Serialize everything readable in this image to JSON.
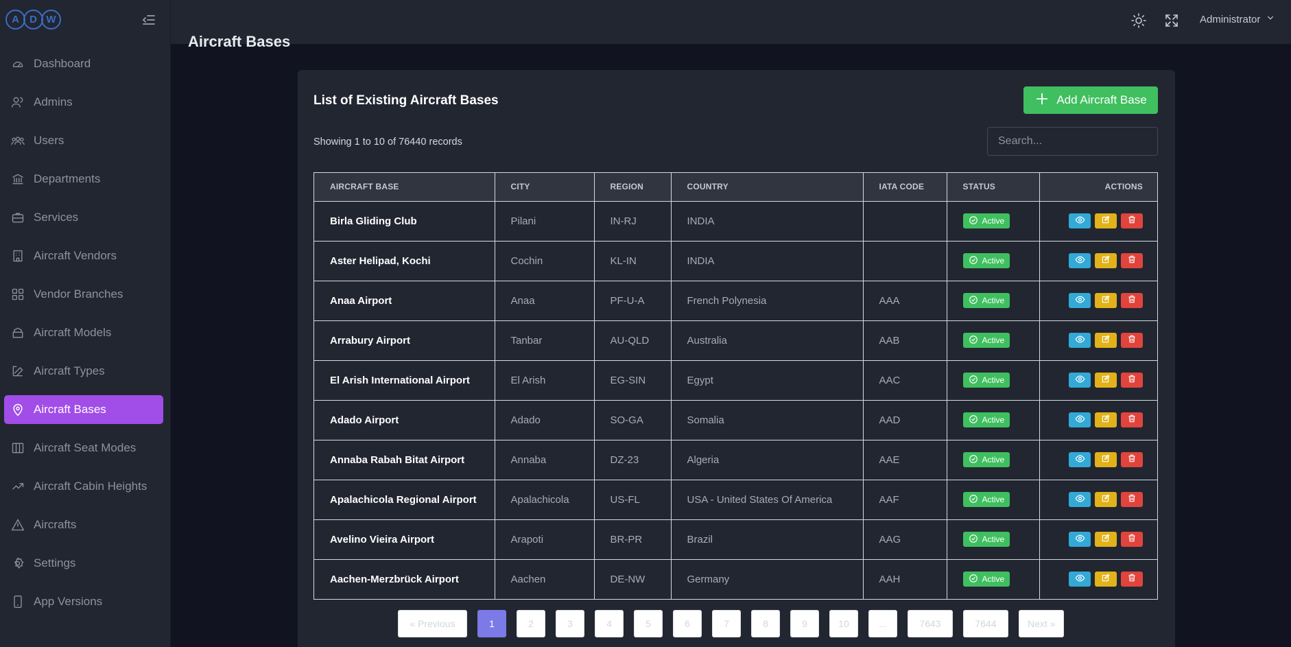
{
  "logo": {
    "letters": [
      "A",
      "D",
      "W"
    ]
  },
  "sidebar": {
    "items": [
      {
        "label": "Dashboard",
        "icon": "dashboard-icon"
      },
      {
        "label": "Admins",
        "icon": "admins-icon"
      },
      {
        "label": "Users",
        "icon": "users-icon"
      },
      {
        "label": "Departments",
        "icon": "departments-icon"
      },
      {
        "label": "Services",
        "icon": "services-icon"
      },
      {
        "label": "Aircraft Vendors",
        "icon": "vendors-icon"
      },
      {
        "label": "Vendor Branches",
        "icon": "branches-icon"
      },
      {
        "label": "Aircraft Models",
        "icon": "models-icon"
      },
      {
        "label": "Aircraft Types",
        "icon": "types-icon"
      },
      {
        "label": "Aircraft Bases",
        "icon": "location-pin-icon",
        "active": true
      },
      {
        "label": "Aircraft Seat Modes",
        "icon": "seat-modes-icon"
      },
      {
        "label": "Aircraft Cabin Heights",
        "icon": "cabin-heights-icon"
      },
      {
        "label": "Aircrafts",
        "icon": "aircrafts-icon"
      },
      {
        "label": "Settings",
        "icon": "settings-icon"
      },
      {
        "label": "App Versions",
        "icon": "app-versions-icon"
      }
    ]
  },
  "header": {
    "user": "Administrator"
  },
  "page": {
    "title": "Aircraft Bases",
    "card_title": "List of Existing Aircraft Bases",
    "add_button": "Add Aircraft Base",
    "records_text": "Showing 1 to 10 of 76440 records",
    "search_placeholder": "Search..."
  },
  "table": {
    "columns": [
      "AIRCRAFT BASE",
      "CITY",
      "REGION",
      "COUNTRY",
      "IATA CODE",
      "STATUS",
      "ACTIONS"
    ],
    "rows": [
      {
        "base": "Birla Gliding Club",
        "city": "Pilani",
        "region": "IN-RJ",
        "country": "INDIA",
        "iata": "",
        "status": "Active"
      },
      {
        "base": "Aster Helipad, Kochi",
        "city": "Cochin",
        "region": "KL-IN",
        "country": "INDIA",
        "iata": "",
        "status": "Active"
      },
      {
        "base": "Anaa Airport",
        "city": "Anaa",
        "region": "PF-U-A",
        "country": "French Polynesia",
        "iata": "AAA",
        "status": "Active"
      },
      {
        "base": "Arrabury Airport",
        "city": "Tanbar",
        "region": "AU-QLD",
        "country": "Australia",
        "iata": "AAB",
        "status": "Active"
      },
      {
        "base": "El Arish International Airport",
        "city": "El Arish",
        "region": "EG-SIN",
        "country": "Egypt",
        "iata": "AAC",
        "status": "Active"
      },
      {
        "base": "Adado Airport",
        "city": "Adado",
        "region": "SO-GA",
        "country": "Somalia",
        "iata": "AAD",
        "status": "Active"
      },
      {
        "base": "Annaba Rabah Bitat Airport",
        "city": "Annaba",
        "region": "DZ-23",
        "country": "Algeria",
        "iata": "AAE",
        "status": "Active"
      },
      {
        "base": "Apalachicola Regional Airport",
        "city": "Apalachicola",
        "region": "US-FL",
        "country": "USA - United States Of America",
        "iata": "AAF",
        "status": "Active"
      },
      {
        "base": "Avelino Vieira Airport",
        "city": "Arapoti",
        "region": "BR-PR",
        "country": "Brazil",
        "iata": "AAG",
        "status": "Active"
      },
      {
        "base": "Aachen-Merzbrück Airport",
        "city": "Aachen",
        "region": "DE-NW",
        "country": "Germany",
        "iata": "AAH",
        "status": "Active"
      }
    ]
  },
  "pagination": {
    "previous": "« Previous",
    "next": "Next »",
    "pages": [
      "1",
      "2",
      "3",
      "4",
      "5",
      "6",
      "7",
      "8",
      "9",
      "10",
      "...",
      "7643",
      "7644"
    ],
    "current": "1"
  },
  "colors": {
    "accent": "#a14de8",
    "success": "#3fbf5f",
    "view": "#33a9d6",
    "edit": "#e2b21a",
    "delete": "#e0443d",
    "page_active": "#7b7ae6"
  }
}
